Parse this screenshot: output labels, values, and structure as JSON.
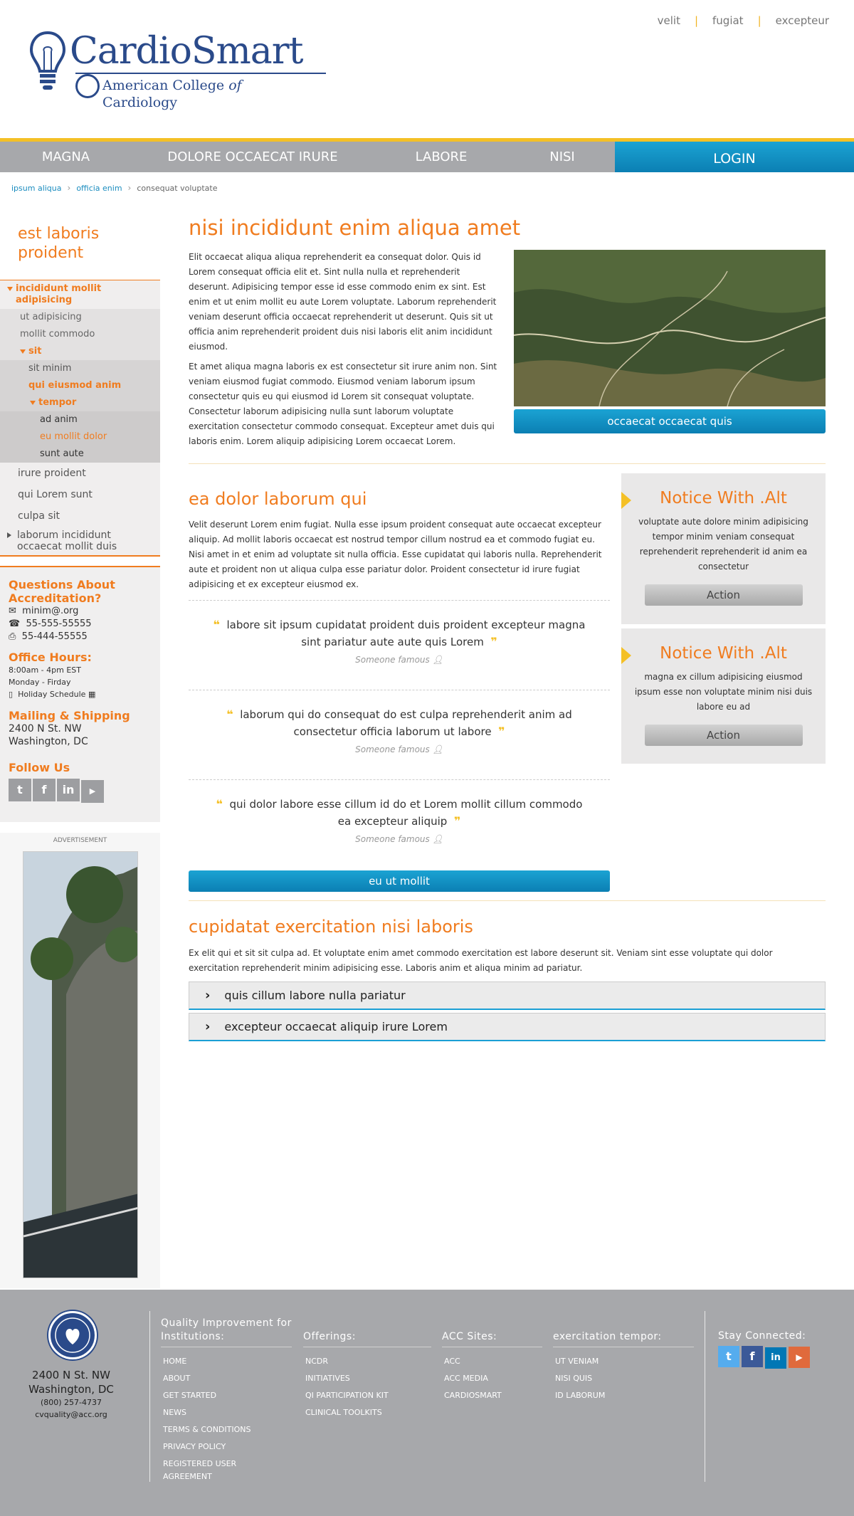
{
  "utility": [
    "velit",
    "fugiat",
    "excepteur"
  ],
  "logo": {
    "brand": "CardioSmart",
    "sub": "American College of Cardiology",
    "sub_of": "of"
  },
  "nav": [
    "MAGNA",
    "DOLORE OCCAECAT IRURE",
    "LABORE",
    "NISI"
  ],
  "nav_login": "LOGIN",
  "breadcrumb": [
    "ipsum aliqua",
    "officia enim",
    "consequat voluptate"
  ],
  "sidebar": {
    "title": "est laboris proident",
    "items": [
      {
        "label": "incididunt mollit adipisicing",
        "level": 1,
        "active": true,
        "expanded": true
      },
      {
        "label": "ut adipisicing",
        "level": 2
      },
      {
        "label": "mollit commodo",
        "level": 2
      },
      {
        "label": "sit",
        "level": 2,
        "active": true,
        "expanded": true
      },
      {
        "label": "sit minim",
        "level": 3
      },
      {
        "label": "qui eiusmod anim",
        "level": 3,
        "active": true
      },
      {
        "label": "tempor",
        "level": 3,
        "active": true,
        "expanded": true
      },
      {
        "label": "ad anim",
        "level": 4
      },
      {
        "label": "eu mollit dolor",
        "level": 4,
        "active": true
      },
      {
        "label": "sunt aute",
        "level": 4
      },
      {
        "label": "irure proident",
        "level": 1
      },
      {
        "label": "qui Lorem sunt",
        "level": 1
      },
      {
        "label": "culpa sit",
        "level": 1
      },
      {
        "label": "laborum incididunt occaecat mollit duis",
        "level": 1,
        "collapsed": true
      }
    ]
  },
  "contact": {
    "questions_title": "Questions About Accreditation?",
    "email": "minim@.org",
    "phone": "55-555-55555",
    "fax": "55-444-55555",
    "hours_title": "Office Hours:",
    "hours": "8:00am - 4pm EST",
    "days": "Monday - Firday",
    "holiday": "Holiday Schedule",
    "mailing_title": "Mailing & Shipping",
    "addr1": "2400 N St. NW",
    "addr2": "Washington, DC",
    "follow_title": "Follow Us"
  },
  "ad_label": "ADVERTISEMENT",
  "main": {
    "title": "nisi incididunt enim aliqua amet",
    "p1": "Elit occaecat aliqua aliqua reprehenderit ea consequat dolor. Quis id Lorem consequat officia elit et. Sint nulla nulla et reprehenderit deserunt. Adipisicing tempor esse id esse commodo enim ex sint. Est enim et ut enim mollit eu aute Lorem voluptate. Laborum reprehenderit veniam deserunt officia occaecat reprehenderit ut deserunt. Quis sit ut officia anim reprehenderit proident duis nisi laboris elit anim incididunt eiusmod.",
    "p2": "Et amet aliqua magna laboris ex est consectetur sit irure anim non. Sint veniam eiusmod fugiat commodo. Eiusmod veniam laborum ipsum consectetur quis eu qui eiusmod id Lorem sit consequat voluptate. Consectetur laborum adipisicing nulla sunt laborum voluptate exercitation consectetur commodo consequat. Excepteur amet duis qui laboris enim. Lorem aliquip adipisicing Lorem occaecat Lorem.",
    "hero_button": "occaecat occaecat quis",
    "section2_title": "ea dolor laborum qui",
    "section2_body": "Velit deserunt Lorem enim fugiat. Nulla esse ipsum proident consequat aute occaecat excepteur aliquip. Ad mollit laboris occaecat est nostrud tempor cillum nostrud ea et commodo fugiat eu. Nisi amet in et enim ad voluptate sit nulla officia. Esse cupidatat qui laboris nulla. Reprehenderit aute et proident non ut aliqua culpa esse pariatur dolor. Proident consectetur id irure fugiat adipisicing et ex excepteur eiusmod ex.",
    "quotes": [
      {
        "text": "labore sit ipsum cupidatat proident duis proident excepteur magna sint pariatur aute aute quis Lorem",
        "author": "Someone famous"
      },
      {
        "text": "laborum qui do consequat do est culpa reprehenderit anim ad consectetur officia laborum ut labore",
        "author": "Someone famous"
      },
      {
        "text": "qui dolor labore esse cillum id do et Lorem mollit cillum commodo ea excepteur aliquip",
        "author": "Someone famous"
      }
    ],
    "quotes_button": "eu ut mollit",
    "notices": [
      {
        "title": "Notice With .Alt",
        "text": "voluptate aute dolore minim adipisicing tempor minim veniam consequat reprehenderit reprehenderit id anim ea consectetur",
        "action": "Action"
      },
      {
        "title": "Notice With .Alt",
        "text": "magna ex cillum adipisicing eiusmod ipsum esse non voluptate minim nisi duis labore eu ad",
        "action": "Action"
      }
    ],
    "section3_title": "cupidatat exercitation nisi laboris",
    "section3_body": "Ex elit qui et sit sit culpa ad. Et voluptate enim amet commodo exercitation est labore deserunt sit. Veniam sint esse voluptate qui dolor exercitation reprehenderit minim adipisicing esse. Laboris anim et aliqua minim ad pariatur.",
    "accordion": [
      "quis cillum labore nulla pariatur",
      "excepteur occaecat aliquip irure Lorem"
    ]
  },
  "footer": {
    "addr1": "2400 N St. NW",
    "addr2": "Washington, DC",
    "phone": "(800) 257-4737",
    "email": "cvquality@acc.org",
    "col1_title": "Quality Improvement for Institutions:",
    "col1": [
      "HOME",
      "ABOUT",
      "GET STARTED",
      "NEWS",
      "TERMS & CONDITIONS",
      "PRIVACY POLICY",
      "REGISTERED USER AGREEMENT"
    ],
    "col2_title": "Offerings:",
    "col2": [
      "NCDR",
      "INITIATIVES",
      "QI PARTICIPATION KIT",
      "CLINICAL TOOLKITS"
    ],
    "col3_title": "ACC Sites:",
    "col3": [
      "ACC",
      "ACC MEDIA",
      "CARDIOSMART"
    ],
    "col4_title": "exercitation tempor:",
    "col4": [
      "UT VENIAM",
      "NISI QUIS",
      "ID LABORUM"
    ],
    "stay_connected": "Stay Connected:"
  },
  "colors": {
    "orange": "#f07c1f",
    "yellow": "#f4c026",
    "blue": "#0b8fc6",
    "gray": "#a7a8ab"
  }
}
